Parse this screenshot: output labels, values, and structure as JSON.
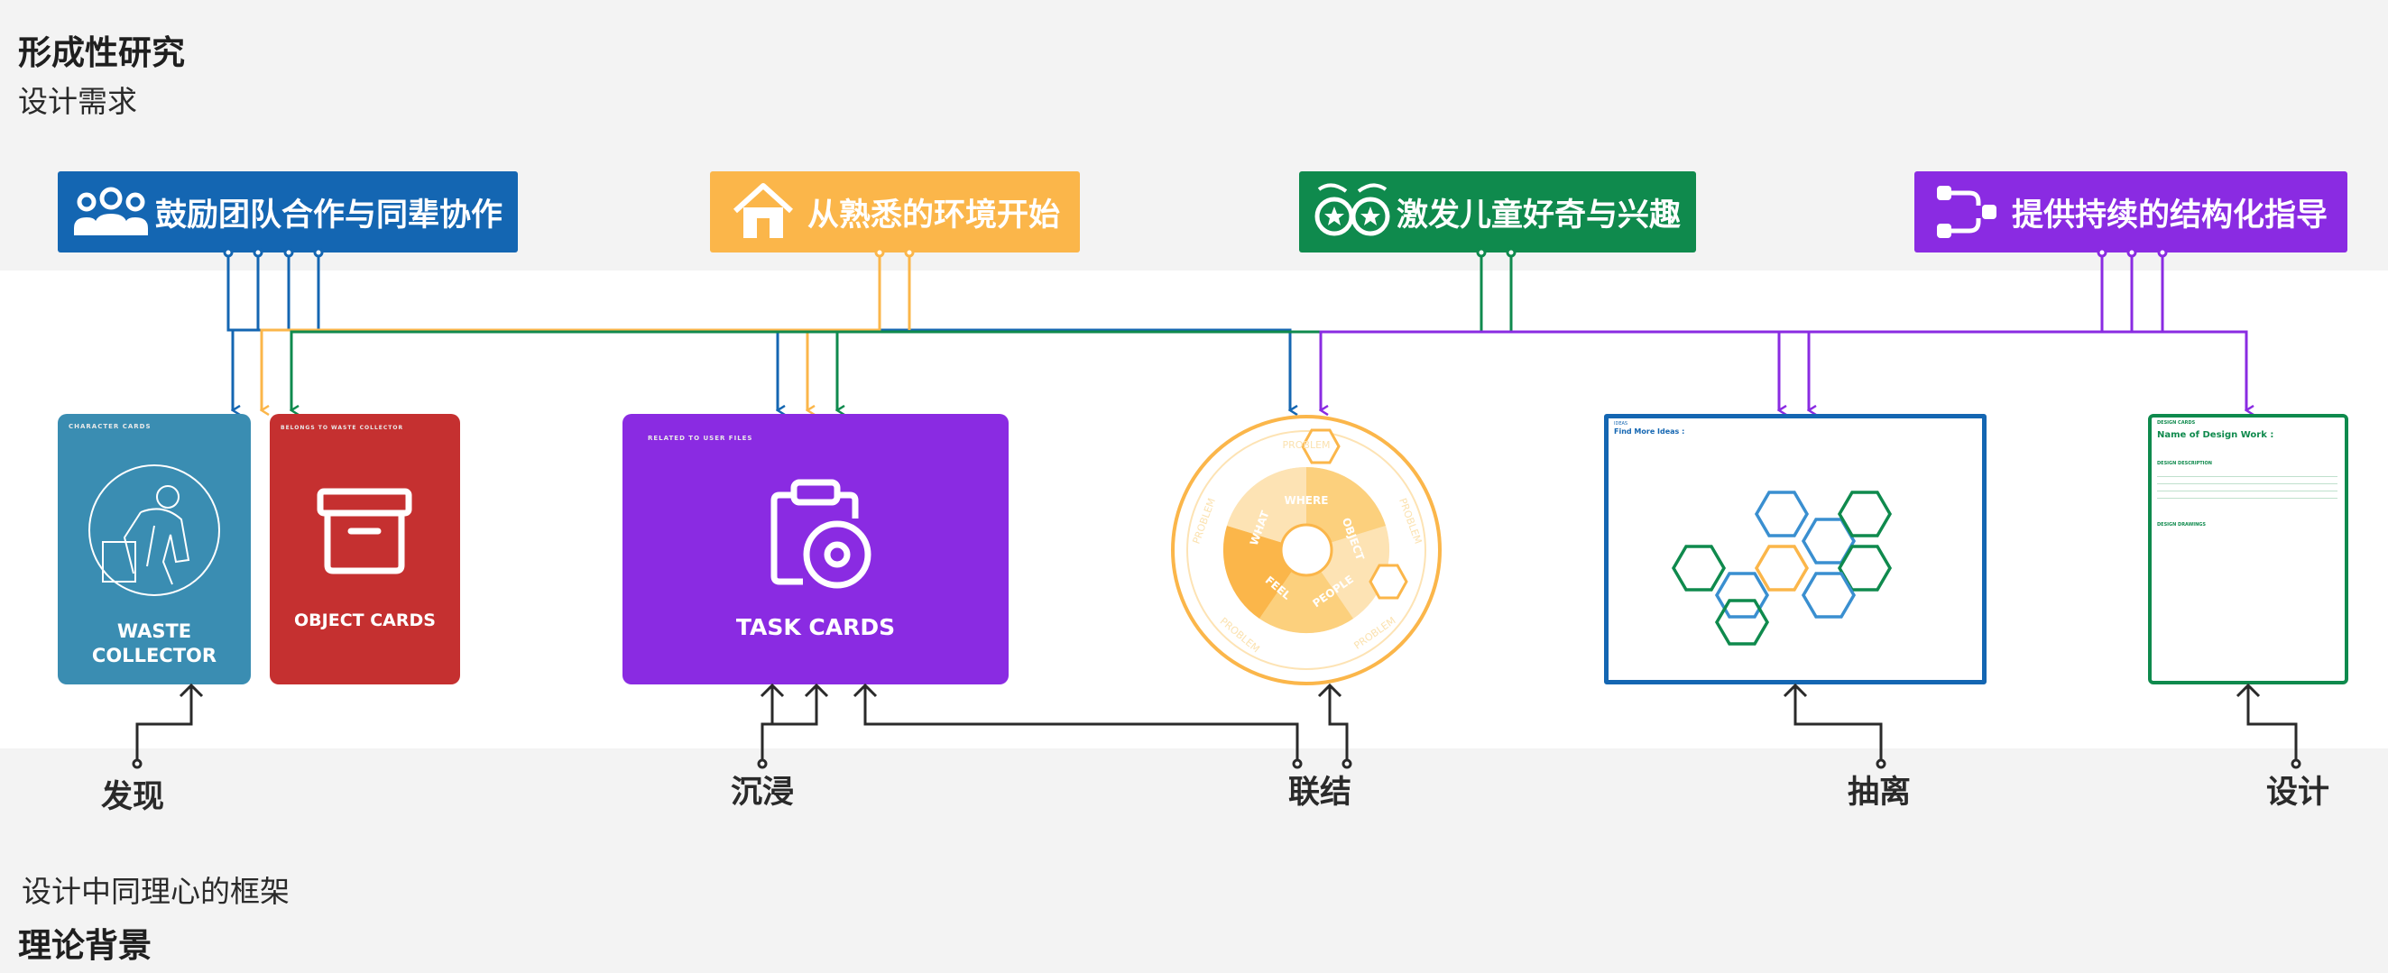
{
  "header": {
    "title": "形成性研究",
    "subtitle": "设计需求"
  },
  "requirements": [
    {
      "label": "鼓励团队合作与同辈协作",
      "icon": "team-icon",
      "color": "#1466b2"
    },
    {
      "label": "从熟悉的环境开始",
      "icon": "house-icon",
      "color": "#fbb64a"
    },
    {
      "label": "激发儿童好奇与兴趣",
      "icon": "owl-eyes-icon",
      "color": "#0f8a4d"
    },
    {
      "label": "提供持续的结构化指导",
      "icon": "flow-icon",
      "color": "#8a2be2"
    }
  ],
  "cards": {
    "character": {
      "tag": "CHARACTER CARDS",
      "title": "WASTE COLLECTOR",
      "color": "#3a8db2"
    },
    "object": {
      "tag": "BELONGS TO WASTE COLLECTOR",
      "title": "OBJECT CARDS",
      "color": "#c53030"
    },
    "task": {
      "tag": "RELATED TO USER FILES",
      "title": "TASK CARDS",
      "color": "#8a2be2"
    },
    "wheel": {
      "center_labels": [
        "WHERE",
        "OBJECT",
        "PEOPLE",
        "FEEL",
        "WHAT"
      ],
      "outer_labels": [
        "PROBLEM",
        "PROBLEM",
        "PROBLEM",
        "PROBLEM",
        "PROBLEM"
      ]
    },
    "ideas": {
      "tag": "IDEAS",
      "title": "Find More Ideas :"
    },
    "design": {
      "tag": "DESIGN CARDS",
      "title": "Name of Design Work :",
      "section1": "DESIGN DESCRIPTION",
      "section2": "DESIGN DRAWINGS"
    }
  },
  "stages": [
    "发现",
    "沉浸",
    "联结",
    "抽离",
    "设计"
  ],
  "footer": {
    "subtitle": "设计中同理心的框架",
    "title": "理论背景"
  }
}
